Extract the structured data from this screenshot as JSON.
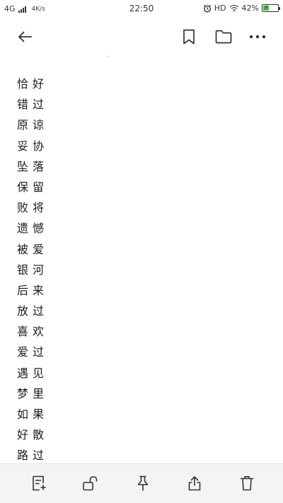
{
  "status_bar": {
    "network": "4G",
    "speed": "4K/s",
    "time": "22:50",
    "hd": "HD",
    "battery_percent": "42%",
    "battery_level": 0.42,
    "battery_color": "#3cc13b"
  },
  "toolbar": {
    "back_icon": "arrow-left-icon",
    "bookmark_icon": "bookmark-icon",
    "folder_icon": "folder-icon",
    "more_icon": "more-horizontal-icon"
  },
  "note": {
    "lines": [
      "恰好",
      "错过",
      "原谅",
      "妥协",
      "坠落",
      "保留",
      "败将",
      "遗憾",
      "被爱",
      "银河",
      "后来",
      "放过",
      "喜欢",
      "爱过",
      "遇见",
      "梦里",
      "如果",
      "好散",
      "路过"
    ]
  },
  "bottom_bar": {
    "edit_icon": "note-edit-icon",
    "lock_icon": "unlock-icon",
    "pin_icon": "pin-icon",
    "share_icon": "share-icon",
    "delete_icon": "trash-icon",
    "background": "#f4f4f4"
  }
}
